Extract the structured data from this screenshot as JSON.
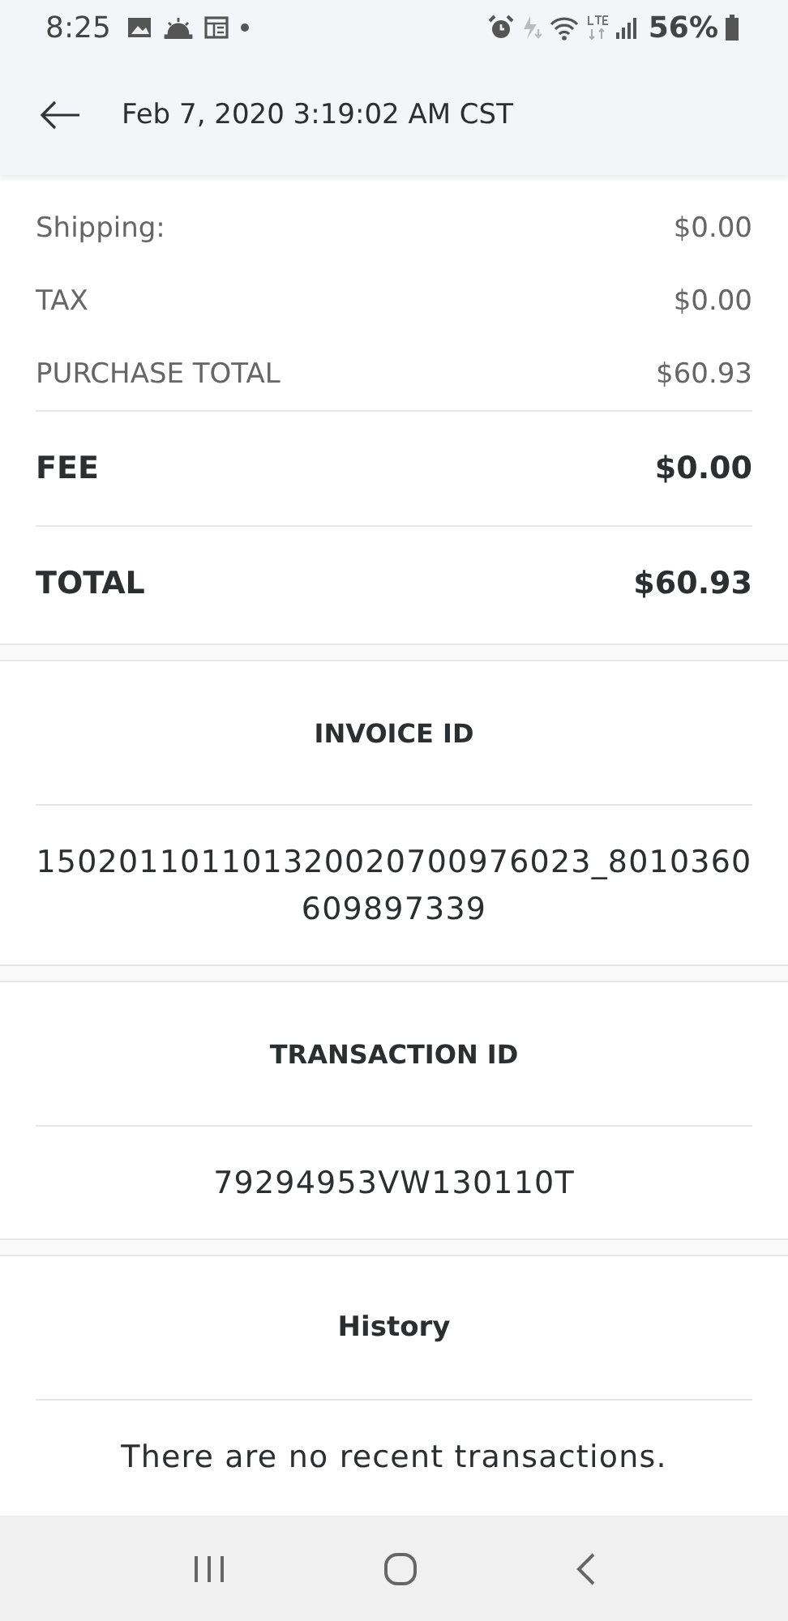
{
  "status_bar": {
    "time": "8:25",
    "battery": "56%"
  },
  "header": {
    "title": "Feb 7, 2020 3:19:02 AM CST"
  },
  "line_items": [
    {
      "label": "Shipping:",
      "amount": "$0.00",
      "kind": "minor"
    },
    {
      "label": "TAX",
      "amount": "$0.00",
      "kind": "minor"
    },
    {
      "label": "PURCHASE TOTAL",
      "amount": "$60.93",
      "kind": "minor"
    },
    {
      "label": "FEE",
      "amount": "$0.00",
      "kind": "major"
    },
    {
      "label": "TOTAL",
      "amount": "$60.93",
      "kind": "major"
    }
  ],
  "sections": [
    {
      "title": "INVOICE ID",
      "value": "150201101101320020700976023_8010360609897339",
      "kind": "caps"
    },
    {
      "title": "TRANSACTION ID",
      "value": "79294953VW130110T",
      "kind": "caps"
    },
    {
      "title": "History",
      "value": "There are no recent transactions.",
      "kind": "plain"
    }
  ]
}
